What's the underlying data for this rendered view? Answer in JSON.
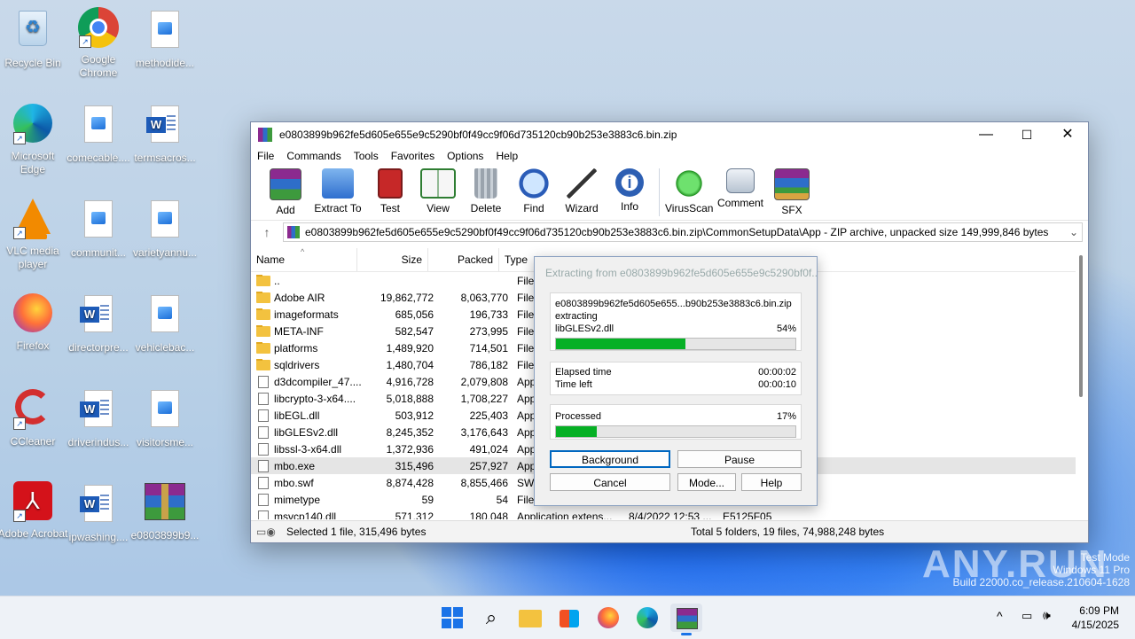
{
  "desktop": {
    "icons": [
      {
        "label": "Recycle Bin",
        "icon": "recycle-bin-icon"
      },
      {
        "label": "Google Chrome",
        "icon": "chrome-icon"
      },
      {
        "label": "methodide...",
        "icon": "image-file-icon"
      },
      {
        "label": "Microsoft Edge",
        "icon": "edge-icon"
      },
      {
        "label": "comecable....",
        "icon": "image-file-icon"
      },
      {
        "label": "termsacros...",
        "icon": "word-file-icon"
      },
      {
        "label": "VLC media player",
        "icon": "vlc-icon"
      },
      {
        "label": "communit...",
        "icon": "image-file-icon"
      },
      {
        "label": "varietyannu...",
        "icon": "image-file-icon"
      },
      {
        "label": "Firefox",
        "icon": "firefox-icon"
      },
      {
        "label": "directorpre...",
        "icon": "word-file-icon"
      },
      {
        "label": "vehiclebac...",
        "icon": "image-file-icon"
      },
      {
        "label": "CCleaner",
        "icon": "ccleaner-icon"
      },
      {
        "label": "driverindus...",
        "icon": "word-file-icon"
      },
      {
        "label": "visitorsme...",
        "icon": "image-file-icon"
      },
      {
        "label": "Adobe Acrobat",
        "icon": "acrobat-icon"
      },
      {
        "label": "ipwashing....",
        "icon": "word-file-icon"
      },
      {
        "label": "e0803899b9...",
        "icon": "winrar-archive-icon"
      }
    ]
  },
  "window": {
    "title": "e0803899b962fe5d605e655e9c5290bf0f49cc9f06d735120cb90b253e3883c6.bin.zip",
    "controls": {
      "minimize": "—",
      "maximize": "☐",
      "close": "✕"
    },
    "menu": [
      "File",
      "Commands",
      "Tools",
      "Favorites",
      "Options",
      "Help"
    ],
    "toolbar": [
      "Add",
      "Extract To",
      "Test",
      "View",
      "Delete",
      "Find",
      "Wizard",
      "Info",
      "VirusScan",
      "Comment",
      "SFX"
    ],
    "address": "e0803899b962fe5d605e655e9c5290bf0f49cc9f06d735120cb90b253e3883c6.bin.zip\\CommonSetupData\\App - ZIP archive, unpacked size 149,999,846 bytes",
    "columns": {
      "name": "Name",
      "size": "Size",
      "packed": "Packed",
      "type": "Type"
    },
    "rows": [
      {
        "name": "..",
        "size": "",
        "packed": "",
        "type": "File fo",
        "modified": "",
        "crc": "",
        "kind": "folder"
      },
      {
        "name": "Adobe AIR",
        "size": "19,862,772",
        "packed": "8,063,770",
        "type": "File fo",
        "modified": "",
        "crc": "",
        "kind": "folder"
      },
      {
        "name": "imageformats",
        "size": "685,056",
        "packed": "196,733",
        "type": "File fo",
        "modified": "",
        "crc": "",
        "kind": "folder"
      },
      {
        "name": "META-INF",
        "size": "582,547",
        "packed": "273,995",
        "type": "File fo",
        "modified": "",
        "crc": "",
        "kind": "folder"
      },
      {
        "name": "platforms",
        "size": "1,489,920",
        "packed": "714,501",
        "type": "File fo",
        "modified": "",
        "crc": "",
        "kind": "folder"
      },
      {
        "name": "sqldrivers",
        "size": "1,480,704",
        "packed": "786,182",
        "type": "File fo",
        "modified": "",
        "crc": "",
        "kind": "folder"
      },
      {
        "name": "d3dcompiler_47....",
        "size": "4,916,728",
        "packed": "2,079,808",
        "type": "Applic",
        "modified": "",
        "crc": "",
        "kind": "file"
      },
      {
        "name": "libcrypto-3-x64....",
        "size": "5,018,888",
        "packed": "1,708,227",
        "type": "Applic",
        "modified": "",
        "crc": "",
        "kind": "file"
      },
      {
        "name": "libEGL.dll",
        "size": "503,912",
        "packed": "225,403",
        "type": "Applic",
        "modified": "",
        "crc": "",
        "kind": "file"
      },
      {
        "name": "libGLESv2.dll",
        "size": "8,245,352",
        "packed": "3,176,643",
        "type": "Applic",
        "modified": "",
        "crc": "",
        "kind": "file"
      },
      {
        "name": "libssl-3-x64.dll",
        "size": "1,372,936",
        "packed": "491,024",
        "type": "Applic",
        "modified": "",
        "crc": "",
        "kind": "file"
      },
      {
        "name": "mbo.exe",
        "size": "315,496",
        "packed": "257,927",
        "type": "Applic",
        "modified": "",
        "crc": "",
        "kind": "file",
        "selected": true
      },
      {
        "name": "mbo.swf",
        "size": "8,874,428",
        "packed": "8,855,466",
        "type": "SWF F",
        "modified": "",
        "crc": "",
        "kind": "file"
      },
      {
        "name": "mimetype",
        "size": "59",
        "packed": "54",
        "type": "File",
        "modified": "",
        "crc": "",
        "kind": "file"
      },
      {
        "name": "msvcp140.dll",
        "size": "571,312",
        "packed": "180,048",
        "type": "Application extens...",
        "modified": "8/4/2022 12:53 ...",
        "crc": "E5125F05",
        "kind": "file"
      }
    ],
    "status_left": "Selected 1 file, 315,496 bytes",
    "status_right": "Total 5 folders, 19 files, 74,988,248 bytes"
  },
  "dialog": {
    "title": "Extracting from e0803899b962fe5d605e655e9c5290bf0f...",
    "archive": "e0803899b962fe5d605e655...b90b253e3883c6.bin.zip",
    "action": "extracting",
    "current_file": "libGLESv2.dll",
    "file_percent": "54%",
    "file_progress": 0.54,
    "elapsed_label": "Elapsed time",
    "elapsed": "00:00:02",
    "left_label": "Time left",
    "left": "00:00:10",
    "processed_label": "Processed",
    "processed_percent": "17%",
    "processed_progress": 0.17,
    "buttons": {
      "background": "Background",
      "pause": "Pause",
      "cancel": "Cancel",
      "mode": "Mode...",
      "help": "Help"
    }
  },
  "taskbar": {
    "time": "6:09 PM",
    "date": "4/15/2025",
    "apps": [
      "windows-start-icon",
      "search-icon",
      "file-explorer-icon",
      "store-icon",
      "firefox-icon",
      "edge-icon",
      "winrar-icon"
    ]
  },
  "watermark": {
    "brand": "ANY.RUN",
    "line1": "Test Mode",
    "line2": "Windows 11 Pro",
    "line3": "Build 22000.co_release.210604-1628"
  }
}
